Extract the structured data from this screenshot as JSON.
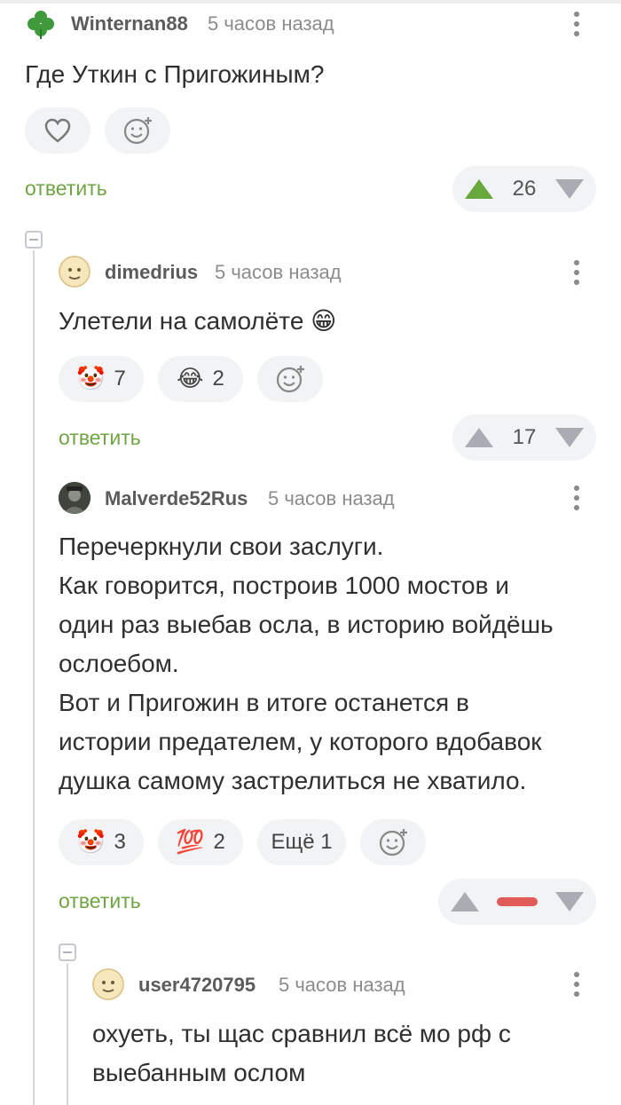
{
  "comments": [
    {
      "user": "Winternan88",
      "time": "5 часов назад",
      "avatar": "clover-avatar",
      "text": "Где Уткин с Пригожиным?",
      "reactions": [],
      "reply_label": "ответить",
      "rating": "26",
      "vote": "up"
    },
    {
      "user": "dimedrius",
      "time": "5 часов назад",
      "avatar": "face-avatar",
      "text": "Улетели на самолёте 😁",
      "reactions": [
        {
          "icon": "🤡",
          "count": "7"
        },
        {
          "icon": "😂",
          "count": "2"
        }
      ],
      "reply_label": "ответить",
      "rating": "17",
      "vote": "none"
    },
    {
      "user": "Malverde52Rus",
      "time": "5 часов назад",
      "avatar": "photo-avatar",
      "text_lines": [
        "Перечеркнули свои заслуги.",
        "Как говорится, построив 1000 мостов и",
        "один раз выебав осла, в историю войдёшь",
        "ослоебом.",
        "Вот и Пригожин в итоге останется в",
        "истории предателем, у которого вдобавок",
        "душка самому застрелиться не хватило."
      ],
      "reactions": [
        {
          "icon": "🤡",
          "count": "3"
        },
        {
          "icon": "💯",
          "count": "2"
        }
      ],
      "more_reactions": "Ещё 1",
      "reply_label": "ответить",
      "rating": "",
      "vote": "down"
    },
    {
      "user": "user4720795",
      "time": "5 часов назад",
      "avatar": "face-avatar",
      "text_lines": [
        "охуеть, ты щас сравнил всё мо рф с",
        "выебанным ослом"
      ]
    }
  ],
  "colors": {
    "accent_green": "#6fa544",
    "upvote_green": "#68a93e",
    "downvote_red": "#e15b58",
    "pill_bg": "#f2f3f5"
  }
}
